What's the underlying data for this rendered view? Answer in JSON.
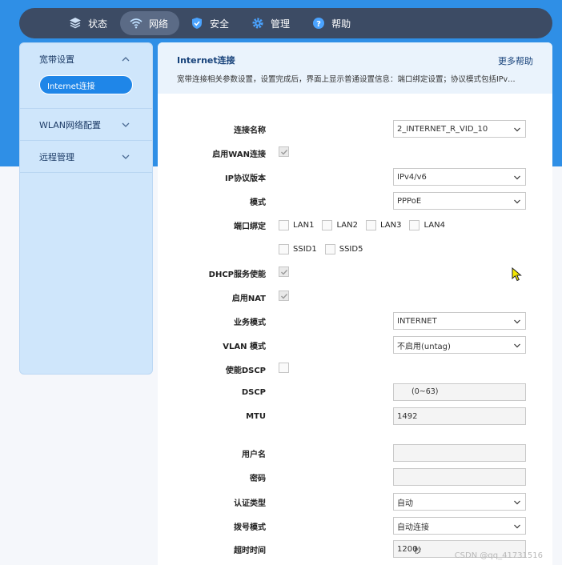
{
  "nav": {
    "items": [
      {
        "label": "状态",
        "icon": "layers-icon"
      },
      {
        "label": "网络",
        "icon": "wifi-icon",
        "active": true
      },
      {
        "label": "安全",
        "icon": "shield-icon"
      },
      {
        "label": "管理",
        "icon": "gear-icon"
      },
      {
        "label": "帮助",
        "icon": "help-icon"
      }
    ]
  },
  "sidebar": {
    "groups": [
      {
        "label": "宽带设置",
        "expanded": true,
        "items": [
          {
            "label": "Internet连接",
            "active": true
          }
        ]
      },
      {
        "label": "WLAN网络配置",
        "expanded": false
      },
      {
        "label": "远程管理",
        "expanded": false
      }
    ]
  },
  "main": {
    "title": "Internet连接",
    "more_help": "更多帮助",
    "description": "宽带连接相关参数设置，设置完成后，界面上显示普通设置信息：端口绑定设置；协议模式包括IPv…"
  },
  "form": {
    "connection_name": {
      "label": "连接名称",
      "value": "2_INTERNET_R_VID_10"
    },
    "enable_wan": {
      "label": "启用WAN连接",
      "checked": true
    },
    "ip_version": {
      "label": "IP协议版本",
      "value": "IPv4/v6"
    },
    "mode": {
      "label": "模式",
      "value": "PPPoE"
    },
    "port_binding": {
      "label": "端口绑定",
      "ports": [
        "LAN1",
        "LAN2",
        "LAN3",
        "LAN4"
      ],
      "ssids": [
        "SSID1",
        "SSID5"
      ]
    },
    "dhcp": {
      "label": "DHCP服务使能",
      "checked": true
    },
    "nat": {
      "label": "启用NAT",
      "checked": true
    },
    "service_mode": {
      "label": "业务模式",
      "value": "INTERNET"
    },
    "vlan_mode": {
      "label": "VLAN 模式",
      "value": "不启用(untag)"
    },
    "dscp_enable": {
      "label": "使能DSCP",
      "checked": false
    },
    "dscp": {
      "label": "DSCP",
      "value": "",
      "hint": "(0~63)"
    },
    "mtu": {
      "label": "MTU",
      "value": "1492"
    },
    "username": {
      "label": "用户名",
      "value": ""
    },
    "password": {
      "label": "密码",
      "value": ""
    },
    "auth_type": {
      "label": "认证类型",
      "value": "自动"
    },
    "dial_mode": {
      "label": "拨号模式",
      "value": "自动连接"
    },
    "timeout": {
      "label": "超时时间",
      "value": "1200",
      "unit": "秒"
    }
  },
  "watermark": "CSDN @qq_41731516",
  "colors": {
    "nav_bg": "#3c4b64",
    "accent": "#1f86e8",
    "band": "#2f8fe6",
    "sidebar_bg": "#cfe6fb"
  }
}
